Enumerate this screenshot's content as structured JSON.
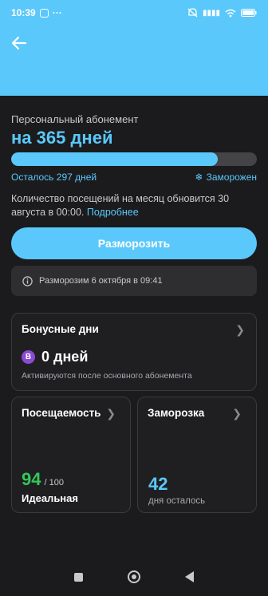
{
  "status_bar": {
    "time": "10:39",
    "dots": "···",
    "mute_icon": "mute-icon",
    "signal": "▮▮▮▮",
    "wifi_icon": "wifi-icon",
    "battery": "▭"
  },
  "subscription": {
    "label": "Персональный абонемент",
    "title": "на 365 дней",
    "progress": 0.84,
    "remaining": "Осталось 297 дней",
    "frozen_label": "Заморожен",
    "info_text": "Количество посещений на месяц обновится 30 августа в 00:00.",
    "info_link": "Подробнее"
  },
  "unfreeze_button": "Разморозить",
  "notice": "Разморозим 6 октября в 09:41",
  "bonus": {
    "title": "Бонусные дни",
    "badge": "B",
    "value": "0 дней",
    "note": "Активируются после основного абонемента"
  },
  "attendance": {
    "title": "Посещаемость",
    "value": "94",
    "total": "/ 100",
    "label": "Идеальная"
  },
  "freeze": {
    "title": "Заморозка",
    "value": "42",
    "label": "дня осталось"
  },
  "colors": {
    "accent": "#5ac8fa",
    "success": "#34c759",
    "badge": "#8a4bd1"
  }
}
